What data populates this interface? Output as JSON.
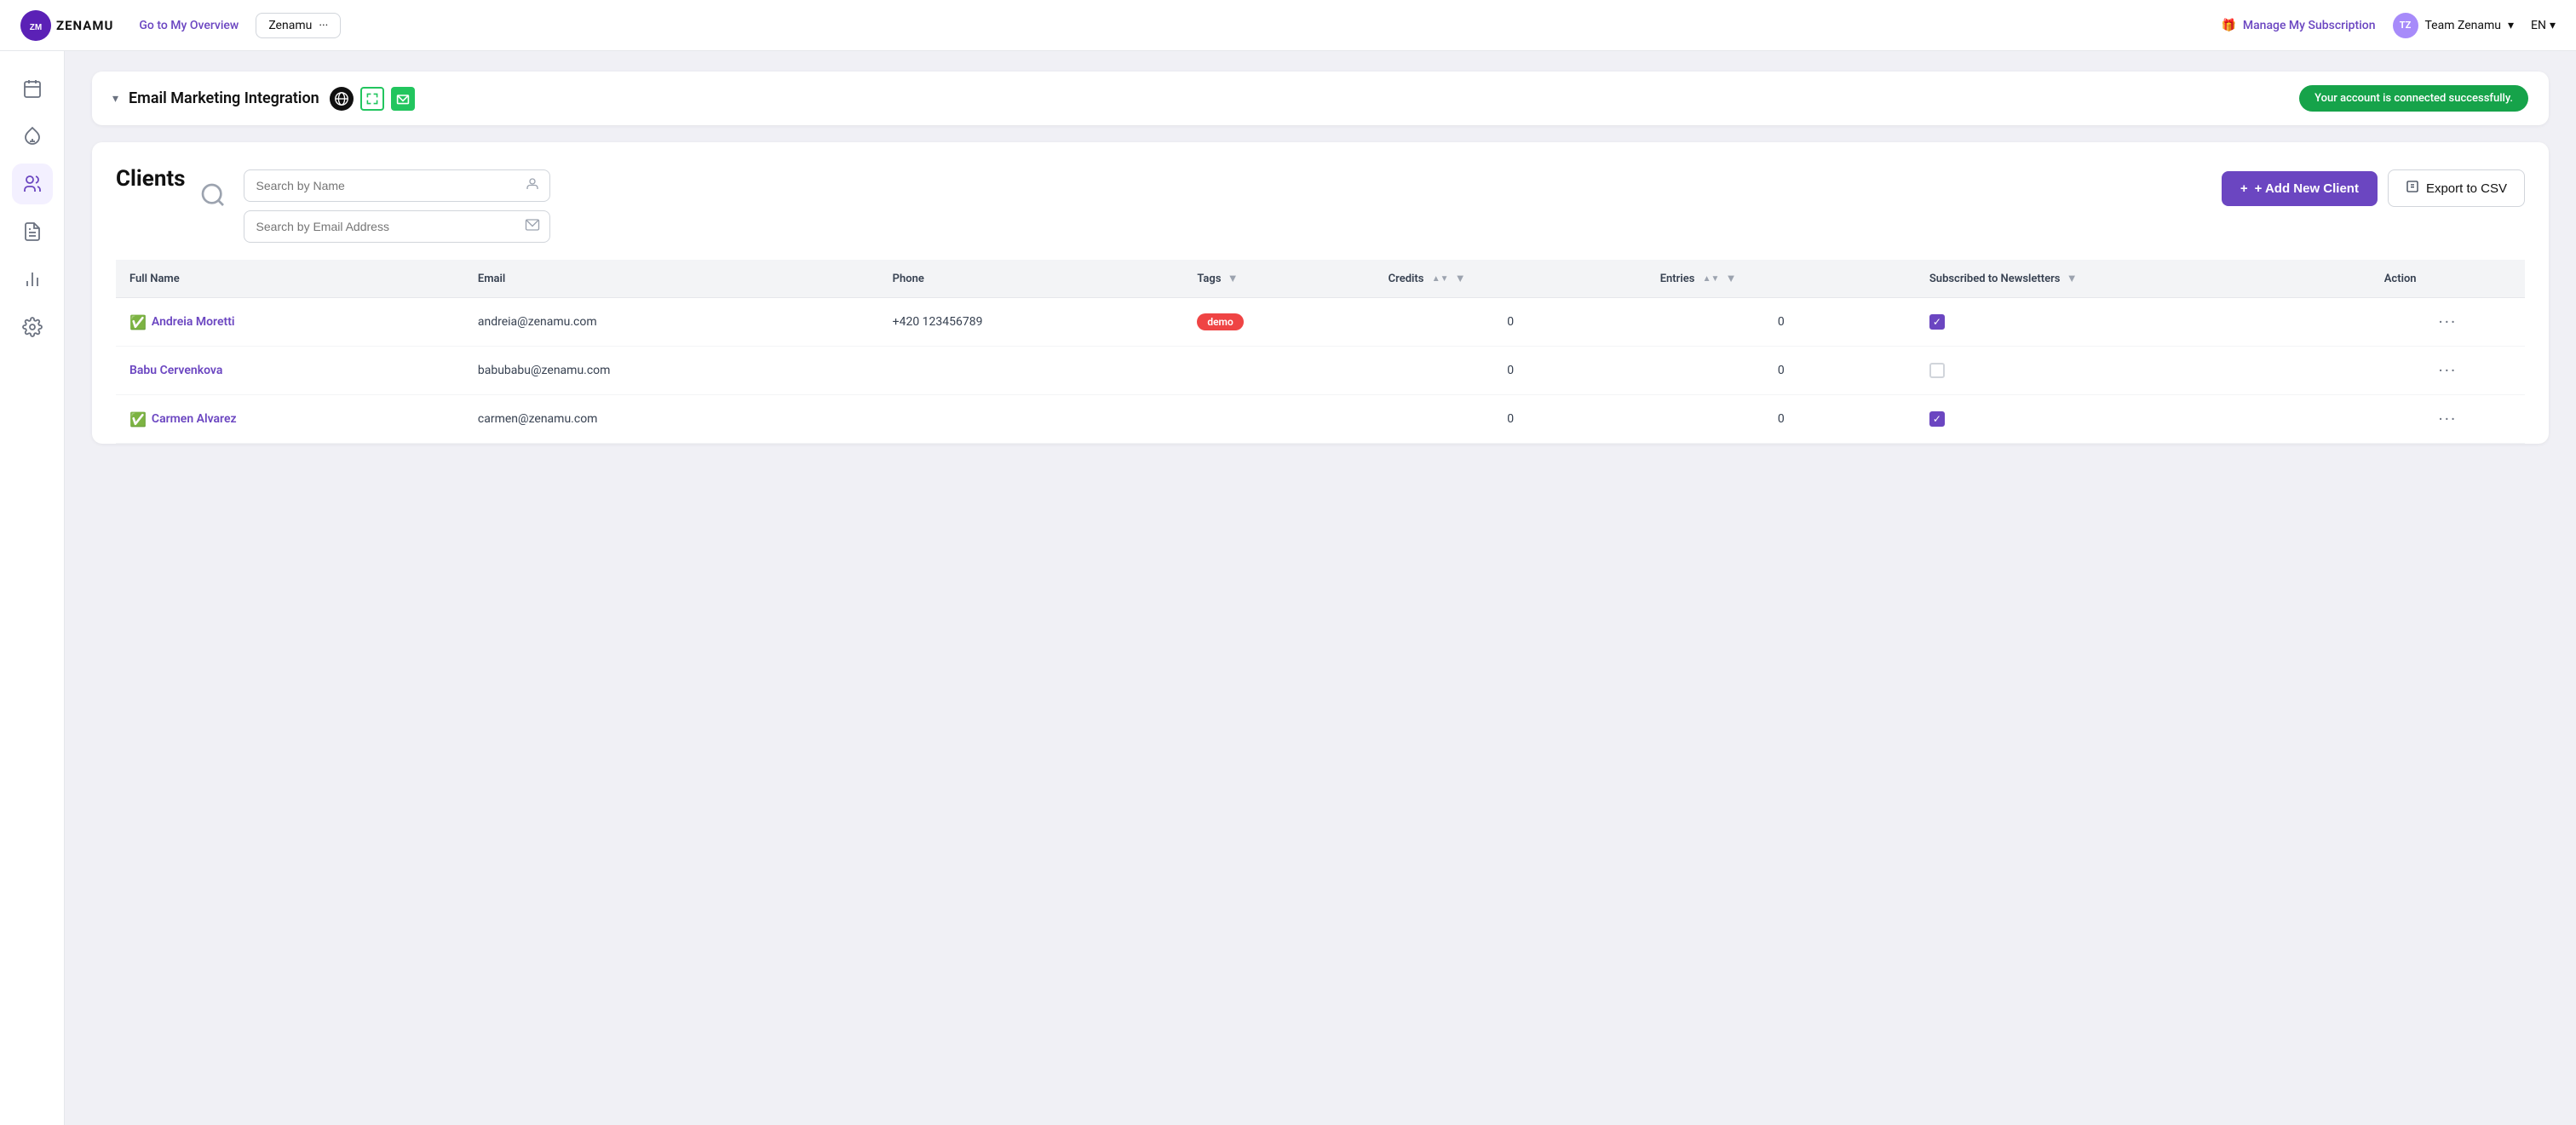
{
  "app": {
    "logo_text": "ZENAMU",
    "nav_link": "Go to My Overview",
    "workspace_name": "Zenamu",
    "manage_subscription": "Manage My Subscription",
    "team_name": "Team Zenamu",
    "language": "EN"
  },
  "sidebar": {
    "items": [
      {
        "id": "calendar",
        "label": "Calendar"
      },
      {
        "id": "clients",
        "label": "Clients"
      },
      {
        "id": "reports",
        "label": "Reports"
      },
      {
        "id": "analytics",
        "label": "Analytics"
      },
      {
        "id": "settings",
        "label": "Settings"
      }
    ]
  },
  "integration": {
    "title": "Email Marketing Integration",
    "connected_badge": "Your account is connected successfully."
  },
  "clients": {
    "title": "Clients",
    "search_name_placeholder": "Search by Name",
    "search_email_placeholder": "Search by Email Address",
    "add_button": "+ Add New Client",
    "export_button": "Export to CSV",
    "table": {
      "columns": [
        {
          "key": "full_name",
          "label": "Full Name"
        },
        {
          "key": "email",
          "label": "Email"
        },
        {
          "key": "phone",
          "label": "Phone"
        },
        {
          "key": "tags",
          "label": "Tags"
        },
        {
          "key": "credits",
          "label": "Credits"
        },
        {
          "key": "entries",
          "label": "Entries"
        },
        {
          "key": "newsletters",
          "label": "Subscribed to Newsletters"
        },
        {
          "key": "action",
          "label": "Action"
        }
      ],
      "rows": [
        {
          "full_name": "Andreia Moretti",
          "email": "andreia@zenamu.com",
          "phone": "+420 123456789",
          "tags": [
            "demo"
          ],
          "credits": 0,
          "entries": 0,
          "subscribed": true,
          "verified": true
        },
        {
          "full_name": "Babu Cervenkova",
          "email": "babubabu@zenamu.com",
          "phone": "",
          "tags": [],
          "credits": 0,
          "entries": 0,
          "subscribed": false,
          "verified": false
        },
        {
          "full_name": "Carmen Alvarez",
          "email": "carmen@zenamu.com",
          "phone": "",
          "tags": [],
          "credits": 0,
          "entries": 0,
          "subscribed": true,
          "verified": true
        }
      ]
    }
  }
}
